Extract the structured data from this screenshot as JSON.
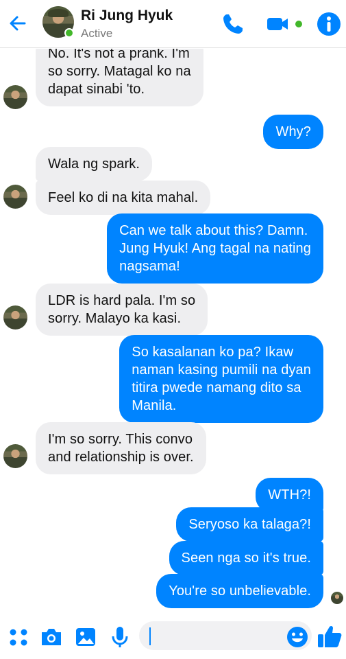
{
  "header": {
    "name": "Ri Jung Hyuk",
    "status": "Active"
  },
  "messages": [
    {
      "from": "them",
      "lines": [
        "No. It's not a prank. I'm",
        "so sorry. Matagal ko na",
        "dapat sinabi 'to."
      ]
    },
    {
      "from": "me",
      "lines": [
        "Why?"
      ]
    },
    {
      "from": "them",
      "lines": [
        "Wala ng spark."
      ]
    },
    {
      "from": "them",
      "lines": [
        "Feel ko di na kita mahal."
      ]
    },
    {
      "from": "me",
      "lines": [
        "Can we talk about this? Damn.",
        "Jung Hyuk! Ang tagal na nating",
        "nagsama!"
      ]
    },
    {
      "from": "them",
      "lines": [
        "LDR is hard pala. I'm so",
        "sorry. Malayo ka kasi."
      ]
    },
    {
      "from": "me",
      "lines": [
        "So kasalanan ko pa? Ikaw",
        "naman kasing pumili na dyan",
        "titira pwede namang dito sa",
        "Manila."
      ]
    },
    {
      "from": "them",
      "lines": [
        "I'm so sorry. This convo",
        "and relationship is over."
      ]
    },
    {
      "from": "me",
      "lines": [
        "WTH?!"
      ]
    },
    {
      "from": "me",
      "lines": [
        "Seryoso ka talaga?!"
      ]
    },
    {
      "from": "me",
      "lines": [
        "Seen nga so it's true."
      ]
    },
    {
      "from": "me",
      "lines": [
        "You're so unbelievable."
      ]
    }
  ],
  "composer": {
    "placeholder": "",
    "icons": [
      "apps-icon",
      "camera-icon",
      "gallery-icon",
      "microphone-icon",
      "emoji-icon",
      "like-icon"
    ]
  },
  "colors": {
    "accent": "#0084ff",
    "incoming_bubble": "#eeeef0",
    "active": "#42b72a"
  }
}
